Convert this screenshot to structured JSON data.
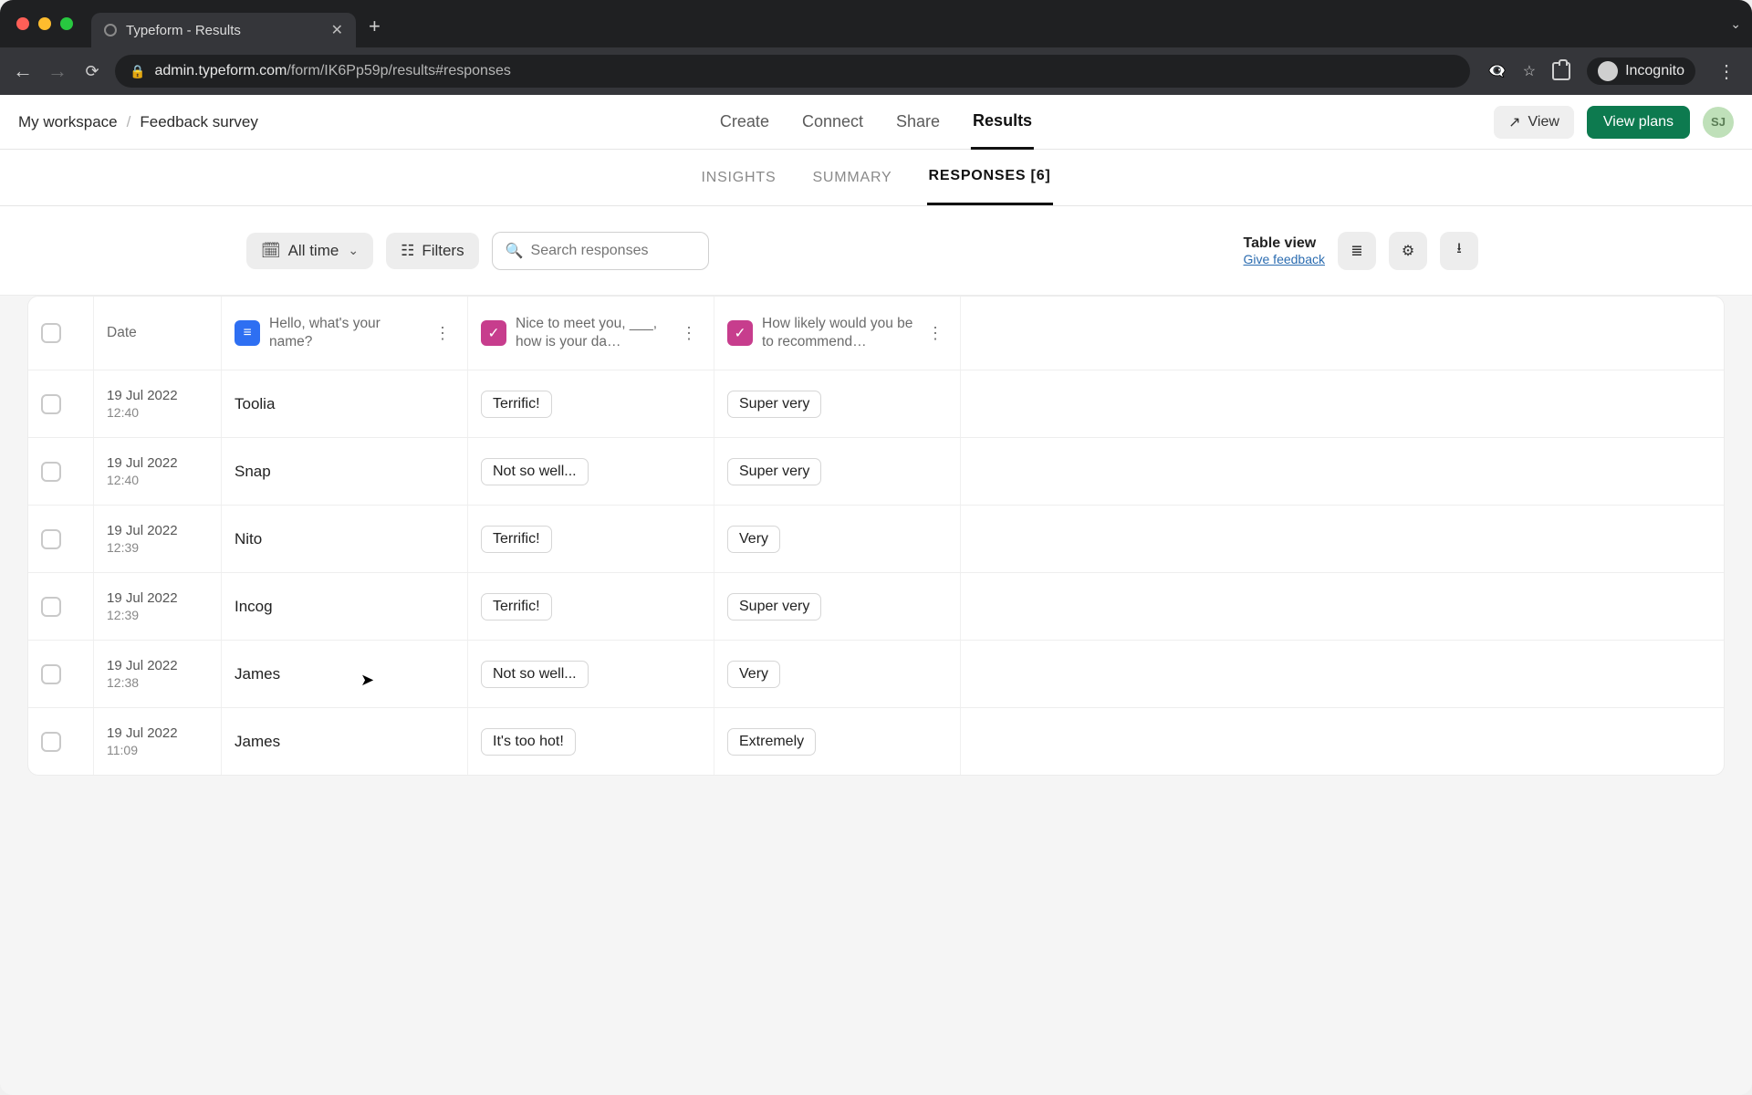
{
  "browser": {
    "tab_title": "Typeform - Results",
    "url_host": "admin.typeform.com",
    "url_path": "/form/IK6Pp59p/results#responses",
    "incognito_label": "Incognito"
  },
  "header": {
    "workspace": "My workspace",
    "separator": "/",
    "form_name": "Feedback survey",
    "main_tabs": {
      "create": "Create",
      "connect": "Connect",
      "share": "Share",
      "results": "Results"
    },
    "view_label": "View",
    "plans_label": "View plans",
    "avatar_initials": "SJ"
  },
  "subnav": {
    "insights": "INSIGHTS",
    "summary": "SUMMARY",
    "responses": "RESPONSES [6]"
  },
  "controls": {
    "date_range": "All time",
    "filters": "Filters",
    "search_placeholder": "Search responses",
    "table_view": "Table view",
    "feedback": "Give feedback"
  },
  "table": {
    "columns": {
      "date": "Date",
      "q1": "Hello, what's your name?",
      "q2": "Nice to meet you, ___, how is your da…",
      "q3": "How likely would you be to recommend…"
    },
    "rows": [
      {
        "date": "19 Jul 2022",
        "time": "12:40",
        "name": "Toolia",
        "q2": "Terrific!",
        "q3": "Super very"
      },
      {
        "date": "19 Jul 2022",
        "time": "12:40",
        "name": "Snap",
        "q2": "Not so well...",
        "q3": "Super very"
      },
      {
        "date": "19 Jul 2022",
        "time": "12:39",
        "name": "Nito",
        "q2": "Terrific!",
        "q3": "Very"
      },
      {
        "date": "19 Jul 2022",
        "time": "12:39",
        "name": "Incog",
        "q2": "Terrific!",
        "q3": "Super very"
      },
      {
        "date": "19 Jul 2022",
        "time": "12:38",
        "name": "James",
        "q2": "Not so well...",
        "q3": "Very"
      },
      {
        "date": "19 Jul 2022",
        "time": "11:09",
        "name": "James",
        "q2": "It's too hot!",
        "q3": "Extremely"
      }
    ]
  }
}
